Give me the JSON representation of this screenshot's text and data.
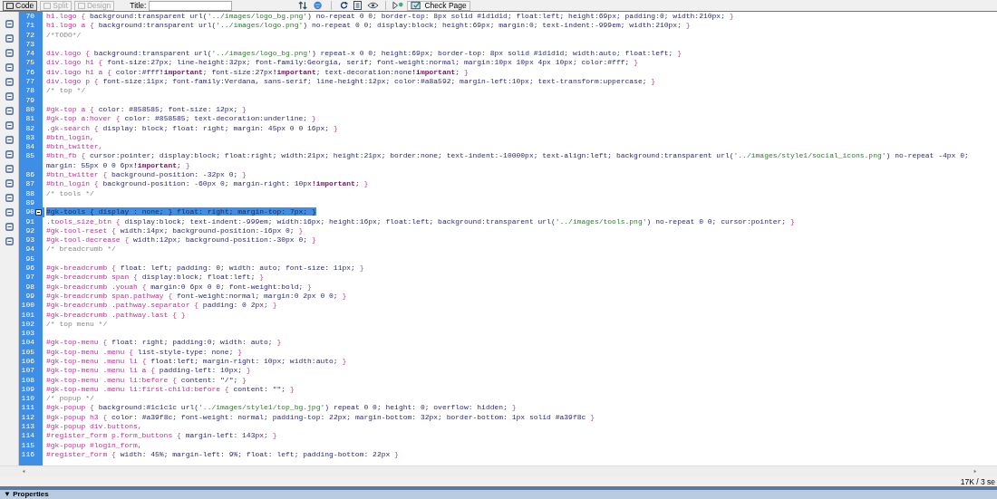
{
  "toolbar": {
    "view_buttons": [
      {
        "label": "Code",
        "selected": true,
        "disabled": false
      },
      {
        "label": "Split",
        "selected": false,
        "disabled": true
      },
      {
        "label": "Design",
        "selected": false,
        "disabled": true
      }
    ],
    "title_label": "Title:",
    "check_page": "Check Page"
  },
  "editor": {
    "lines": [
      {
        "number": "70",
        "text": "h1.logo { background:transparent url('../images/logo_bg.png') no-repeat 0 0; border-top: 8px solid #1d1d1d; float:left; height:69px; padding:0; width:210px; }",
        "selected": false,
        "fold": false
      },
      {
        "number": "71",
        "text": "h1.logo a { background:transparent url('../images/logo.png') no-repeat 0 0; display:block; height:69px; margin:0; text-indent:-999em; width:210px; }",
        "selected": false,
        "fold": false
      },
      {
        "number": "72",
        "text": "/*TODO*/",
        "selected": false,
        "fold": false
      },
      {
        "number": "73",
        "selected": false,
        "fold": false
      },
      {
        "number": "74",
        "text": "div.logo { background:transparent url('../images/logo_bg.png') repeat-x 0 0; height:69px; border-top: 8px solid #1d1d1d; width:auto; float:left; }",
        "selected": false,
        "fold": false
      },
      {
        "number": "75",
        "text": "div.logo h1 { font-size:27px; line-height:32px; font-family:Georgia, serif; font-weight:normal; margin:10px 10px 4px 10px; color:#fff; }",
        "selected": false,
        "fold": false
      },
      {
        "number": "76",
        "text": "div.logo h1 a { color:#fff!important; font-size:27px!important; text-decoration:none!important; }",
        "selected": false,
        "fold": false
      },
      {
        "number": "77",
        "text": "div.logo p { font-size:11px; font-family:Verdana, sans-serif; line-height:12px; color:#a8a592; margin-left:10px; text-transform:uppercase; }",
        "selected": false,
        "fold": false
      },
      {
        "number": "78",
        "text": "/* top */",
        "selected": false,
        "fold": false
      },
      {
        "number": "79",
        "selected": false,
        "fold": false
      },
      {
        "number": "80",
        "text": "#gk-top a { color: #858585; font-size: 12px; }",
        "selected": false,
        "fold": false
      },
      {
        "number": "81",
        "text": "#gk-top a:hover { color: #858585; text-decoration:underline; }",
        "selected": false,
        "fold": false
      },
      {
        "number": "82",
        "text": ".gk-search { display: block; float: right; margin: 45px 0 0 16px; }",
        "selected": false,
        "fold": false
      },
      {
        "number": "83",
        "text": "#btn_login,",
        "selected": false,
        "fold": false
      },
      {
        "number": "84",
        "text": "#btn_twitter,",
        "selected": false,
        "fold": false
      },
      {
        "number": "85",
        "text": "#btn_fb { cursor:pointer; display:block; float:right; width:21px; height:21px; border:none; text-indent:-10000px; text-align:left; background:transparent url('../images/style1/social_icons.png') no-repeat -4px 0; margin: 55px 0 0 6px!important; }",
        "selected": false,
        "fold": false
      },
      {
        "number": "86",
        "text": "#btn_twitter { background-position: -32px 0; }",
        "selected": false,
        "fold": false
      },
      {
        "number": "87",
        "text": "#btn_login { background-position: -60px 0; margin-right: 10px!important; }",
        "selected": false,
        "fold": false
      },
      {
        "number": "88",
        "text": "/* tools */",
        "selected": false,
        "fold": false
      },
      {
        "number": "89",
        "selected": false,
        "fold": false
      },
      {
        "number": "90",
        "text": "#gk-tools { display : none; } float: right; margin-top: 7px; }",
        "selected": true,
        "fold": true
      },
      {
        "number": "91",
        "text": ".tools_size_btn { display:block; text-indent:-999em; width:16px; height:16px; float:left; background:transparent url('../images/tools.png') no-repeat 0 0; cursor:pointer; }",
        "selected": false,
        "fold": false
      },
      {
        "number": "92",
        "text": "#gk-tool-reset { width:14px; background-position:-16px 0; }",
        "selected": false,
        "fold": false
      },
      {
        "number": "93",
        "text": "#gk-tool-decrease { width:12px; background-position:-30px 0; }",
        "selected": false,
        "fold": false
      },
      {
        "number": "94",
        "text": "/* breadcrumb */",
        "selected": false,
        "fold": false
      },
      {
        "number": "95",
        "selected": false,
        "fold": false
      },
      {
        "number": "96",
        "text": "#gk-breadcrumb { float: left; padding: 0; width: auto; font-size: 11px; }",
        "selected": false,
        "fold": false
      },
      {
        "number": "97",
        "text": "#gk-breadcrumb span { display:block; float:left; }",
        "selected": false,
        "fold": false
      },
      {
        "number": "98",
        "text": "#gk-breadcrumb .youah { margin:0 6px 0 0; font-weight:bold; }",
        "selected": false,
        "fold": false
      },
      {
        "number": "99",
        "text": "#gk-breadcrumb span.pathway { font-weight:normal; margin:0 2px 0 0; }",
        "selected": false,
        "fold": false
      },
      {
        "number": "100",
        "text": "#gk-breadcrumb .pathway.separator { padding: 0 2px; }",
        "selected": false,
        "fold": false
      },
      {
        "number": "101",
        "text": "#gk-breadcrumb .pathway.last { }",
        "selected": false,
        "fold": false
      },
      {
        "number": "102",
        "text": "/* top menu */",
        "selected": false,
        "fold": false
      },
      {
        "number": "103",
        "selected": false,
        "fold": false
      },
      {
        "number": "104",
        "text": "#gk-top-menu { float: right; padding:0; width: auto; }",
        "selected": false,
        "fold": false
      },
      {
        "number": "105",
        "text": "#gk-top-menu .menu { list-style-type: none; }",
        "selected": false,
        "fold": false
      },
      {
        "number": "106",
        "text": "#gk-top-menu .menu li { float:left; margin-right: 10px; width:auto; }",
        "selected": false,
        "fold": false
      },
      {
        "number": "107",
        "text": "#gk-top-menu .menu li a { padding-left: 10px; }",
        "selected": false,
        "fold": false
      },
      {
        "number": "108",
        "text": "#gk-top-menu .menu li:before { content: \"/\"; }",
        "selected": false,
        "fold": false
      },
      {
        "number": "109",
        "text": "#gk-top-menu .menu li:first-child:before { content: \"\"; }",
        "selected": false,
        "fold": false
      },
      {
        "number": "110",
        "text": "/* popup */",
        "selected": false,
        "fold": false
      },
      {
        "number": "111",
        "text": "#gk-popup { background:#1c1c1c url('../images/style1/top_bg.jpg') repeat 0 0; height: 0; overflow: hidden; }",
        "selected": false,
        "fold": false
      },
      {
        "number": "112",
        "text": "#gk-popup h3 { color: #a39f8c; font-weight: normal; padding-top: 22px; margin-bottom: 32px; border-bottom: 1px solid #a39f8c }",
        "selected": false,
        "fold": false
      },
      {
        "number": "113",
        "text": "#gk-popup div.buttons,",
        "selected": false,
        "fold": false
      },
      {
        "number": "114",
        "text": "#register_form p.form_buttons { margin-left: 143px; }",
        "selected": false,
        "fold": false
      },
      {
        "number": "115",
        "text": "#gk-popup #login_form,",
        "selected": false,
        "fold": false
      },
      {
        "number": "116",
        "text": "#register_form { width: 45%; margin-left: 9%; float: left; padding-bottom: 22px }",
        "selected": false,
        "fold": false
      }
    ]
  },
  "status_bar": {
    "size": "17K / 3 se"
  },
  "properties_panel": {
    "toggle": "▼",
    "title": "Properties"
  }
}
